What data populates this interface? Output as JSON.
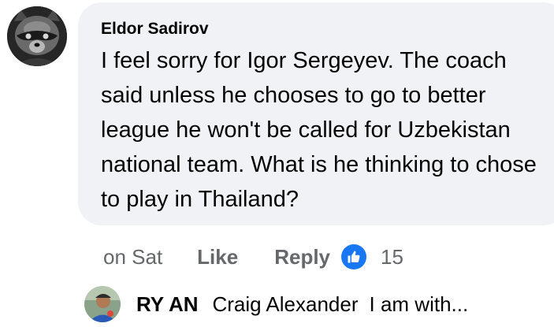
{
  "comment": {
    "author": "Eldor Sadirov",
    "text": "I feel sorry for Igor Sergeyev. The coach said unless he chooses to go to better league he won't be called for Uzbekistan national team. What is he thinking to chose to play in Thailand?",
    "avatar_icon": "raccoon-avatar",
    "timestamp": "on Sat",
    "like_label": "Like",
    "reply_label": "Reply",
    "reaction_icon": "thumbs-up-icon",
    "reaction_count": "15"
  },
  "reply_preview": {
    "avatar_icon": "reply-avatar",
    "author": "RY AN",
    "mention": "Craig Alexander",
    "text": "I am with..."
  },
  "colors": {
    "bubble": "#f0f2f5",
    "text": "#050505",
    "secondary_text": "#65676b",
    "like_blue": "#1877f2"
  }
}
